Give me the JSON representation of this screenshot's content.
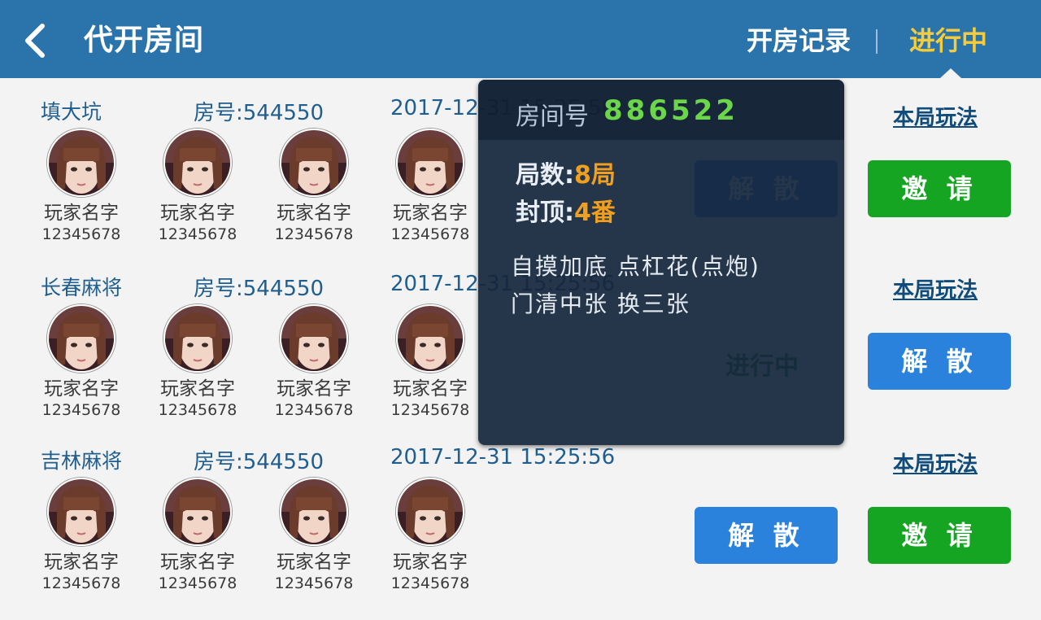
{
  "header": {
    "title": "代开房间",
    "tabs": [
      {
        "label": "开房记录",
        "active": false
      },
      {
        "label": "进行中",
        "active": true
      }
    ]
  },
  "rooms": [
    {
      "game": "填大坑",
      "room_id": "房号:544550",
      "time": "2017-12-31  15:25:56",
      "players": [
        {
          "name": "玩家名字",
          "id": "12345678"
        },
        {
          "name": "玩家名字",
          "id": "12345678"
        },
        {
          "name": "玩家名字",
          "id": "12345678"
        },
        {
          "name": "玩家名字",
          "id": "12345678"
        }
      ],
      "rules_link": "本局玩法",
      "dismiss_label": "解 散",
      "invite_label": "邀 请"
    },
    {
      "game": "长春麻将",
      "room_id": "房号:544550",
      "time": "2017-12-31  15:25:56",
      "players": [
        {
          "name": "玩家名字",
          "id": "12345678"
        },
        {
          "name": "玩家名字",
          "id": "12345678"
        },
        {
          "name": "玩家名字",
          "id": "12345678"
        },
        {
          "name": "玩家名字",
          "id": "12345678"
        }
      ],
      "rules_link": "本局玩法",
      "status": "进行中",
      "dismiss_label": "解 散"
    },
    {
      "game": "吉林麻将",
      "room_id": "房号:544550",
      "time": "2017-12-31  15:25:56",
      "players": [
        {
          "name": "玩家名字",
          "id": "12345678"
        },
        {
          "name": "玩家名字",
          "id": "12345678"
        },
        {
          "name": "玩家名字",
          "id": "12345678"
        },
        {
          "name": "玩家名字",
          "id": "12345678"
        }
      ],
      "rules_link": "本局玩法",
      "dismiss_label": "解 散",
      "invite_label": "邀 请"
    }
  ],
  "rules_popup": {
    "room_label": "房间号",
    "room_number": "886522",
    "rounds_label": "局数:",
    "rounds_value": "8局",
    "cap_label": "封顶:",
    "cap_value": "4番",
    "rule_lines": [
      "自摸加底  点杠花(点炮)",
      "门清中张  换三张"
    ]
  },
  "colors": {
    "header_bg": "#2a74ab",
    "active_tab": "#f5cc3b",
    "invite_button": "#16a423",
    "dismiss_button": "#2a82dc",
    "room_number": "#6bd64a",
    "popup_value": "#f0a01e"
  }
}
